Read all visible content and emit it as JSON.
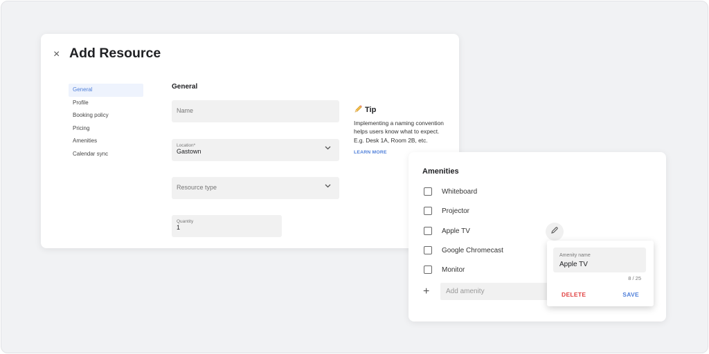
{
  "dialog": {
    "title": "Add Resource",
    "close_icon": "×",
    "sidenav": [
      "General",
      "Profile",
      "Booking policy",
      "Pricing",
      "Amenities",
      "Calendar sync"
    ],
    "active_nav": "General",
    "section_title": "General",
    "fields": {
      "name": {
        "placeholder": "Name"
      },
      "location": {
        "label": "Location*",
        "value": "Gastown"
      },
      "resource_type": {
        "placeholder": "Resource type"
      },
      "quantity": {
        "label": "Quantity",
        "value": "1"
      }
    },
    "chevron": "⌄",
    "tip": {
      "icon": "✏️",
      "title": "Tip",
      "body": "Implementing a naming convention helps users know what to expect. E.g. Desk 1A, Room 2B, etc.",
      "link": "LEARN MORE"
    }
  },
  "amenities": {
    "title": "Amenities",
    "items": [
      "Whiteboard",
      "Projector",
      "Apple TV",
      "Google Chromecast",
      "Monitor"
    ],
    "add_icon": "+",
    "add_placeholder": "Add amenity"
  },
  "edit_popover": {
    "field_label": "Amenity name",
    "field_value": "Apple TV",
    "counter": "8 / 25",
    "delete_label": "DELETE",
    "save_label": "SAVE"
  },
  "colors": {
    "accent": "#4f7fd9",
    "danger": "#e04040",
    "background": "#f1f2f4"
  }
}
